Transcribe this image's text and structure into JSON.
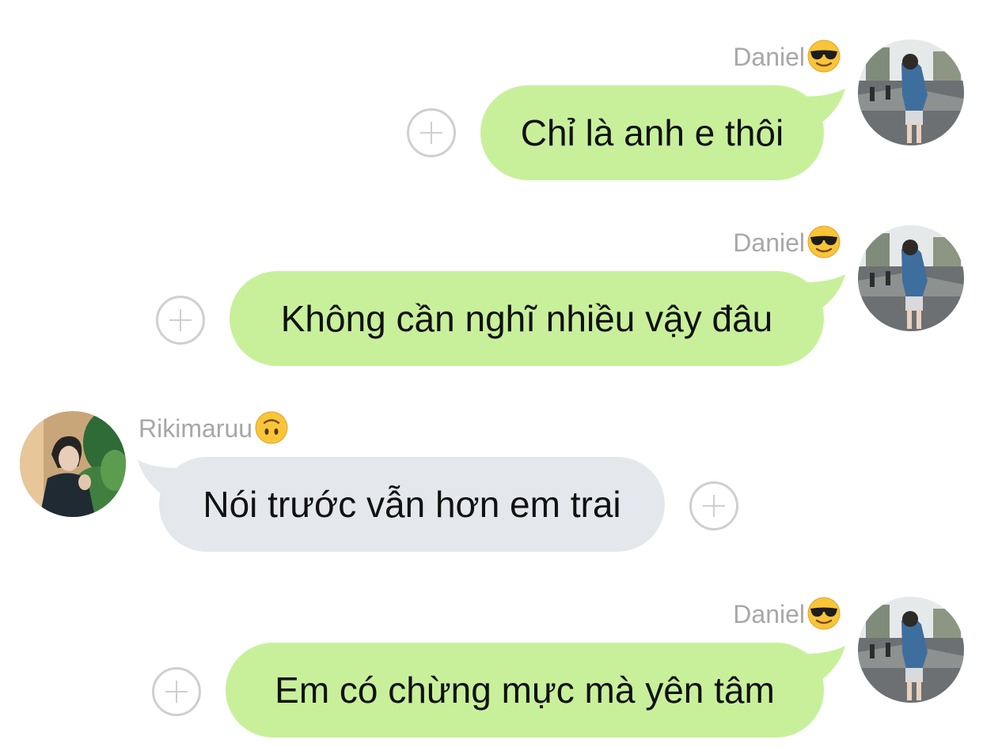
{
  "messages": [
    {
      "sender": "Daniel",
      "sender_emoji": "smiling-face-with-sunglasses",
      "text": "Chỉ là anh e thôi",
      "direction": "outgoing"
    },
    {
      "sender": "Daniel",
      "sender_emoji": "smiling-face-with-sunglasses",
      "text": "Không cần nghĩ nhiều vậy đâu",
      "direction": "outgoing"
    },
    {
      "sender": "Rikimaruu",
      "sender_emoji": "upside-down-face",
      "text": "Nói trước vẫn hơn em trai",
      "direction": "incoming"
    },
    {
      "sender": "Daniel",
      "sender_emoji": "smiling-face-with-sunglasses",
      "text": "Em có chừng mực mà yên tâm",
      "direction": "outgoing"
    }
  ],
  "colors": {
    "outgoing_bubble": "#c8f09b",
    "incoming_bubble": "#e4e8ec",
    "sender_name": "#a7a7a7",
    "react_button": "#cfcfcf"
  },
  "icons": {
    "react_button": "plus-circle-icon"
  }
}
